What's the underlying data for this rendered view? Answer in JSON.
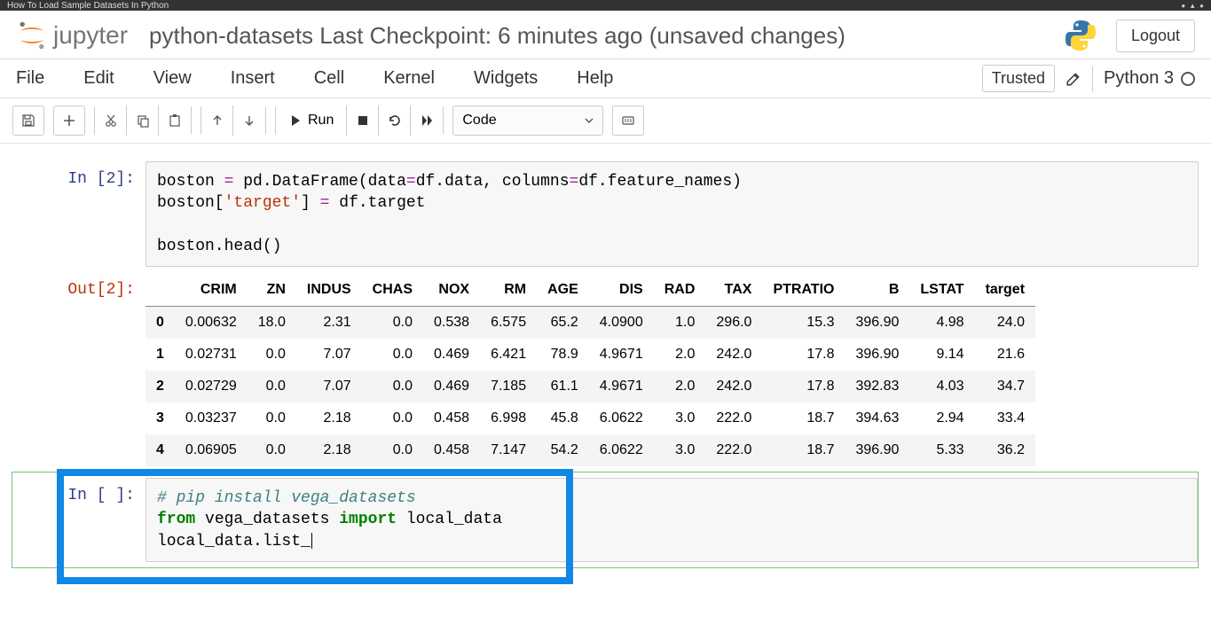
{
  "browser_tab_title": "How To Load Sample Datasets In Python",
  "logo_text": "jupyter",
  "notebook_title": "python-datasets Last Checkpoint: 6 minutes ago  (unsaved changes)",
  "logout_label": "Logout",
  "menus": {
    "file": "File",
    "edit": "Edit",
    "view": "View",
    "insert": "Insert",
    "cell": "Cell",
    "kernel": "Kernel",
    "widgets": "Widgets",
    "help": "Help"
  },
  "trusted_label": "Trusted",
  "kernel_label": "Python 3",
  "toolbar": {
    "run_label": "Run",
    "celltype_selected": "Code"
  },
  "cell1": {
    "prompt": "In [2]:",
    "code_line1a": "boston ",
    "code_line1b": "=",
    "code_line1c": " pd.DataFrame(data",
    "code_line1d": "=",
    "code_line1e": "df.data, columns",
    "code_line1f": "=",
    "code_line1g": "df.feature_names)",
    "code_line2a": "boston[",
    "code_line2b": "'target'",
    "code_line2c": "] ",
    "code_line2d": "=",
    "code_line2e": " df.target",
    "code_line3": "",
    "code_line4": "boston.head()"
  },
  "out1_prompt": "Out[2]:",
  "table": {
    "columns": [
      "CRIM",
      "ZN",
      "INDUS",
      "CHAS",
      "NOX",
      "RM",
      "AGE",
      "DIS",
      "RAD",
      "TAX",
      "PTRATIO",
      "B",
      "LSTAT",
      "target"
    ],
    "rows": [
      {
        "idx": "0",
        "vals": [
          "0.00632",
          "18.0",
          "2.31",
          "0.0",
          "0.538",
          "6.575",
          "65.2",
          "4.0900",
          "1.0",
          "296.0",
          "15.3",
          "396.90",
          "4.98",
          "24.0"
        ]
      },
      {
        "idx": "1",
        "vals": [
          "0.02731",
          "0.0",
          "7.07",
          "0.0",
          "0.469",
          "6.421",
          "78.9",
          "4.9671",
          "2.0",
          "242.0",
          "17.8",
          "396.90",
          "9.14",
          "21.6"
        ]
      },
      {
        "idx": "2",
        "vals": [
          "0.02729",
          "0.0",
          "7.07",
          "0.0",
          "0.469",
          "7.185",
          "61.1",
          "4.9671",
          "2.0",
          "242.0",
          "17.8",
          "392.83",
          "4.03",
          "34.7"
        ]
      },
      {
        "idx": "3",
        "vals": [
          "0.03237",
          "0.0",
          "2.18",
          "0.0",
          "0.458",
          "6.998",
          "45.8",
          "6.0622",
          "3.0",
          "222.0",
          "18.7",
          "394.63",
          "2.94",
          "33.4"
        ]
      },
      {
        "idx": "4",
        "vals": [
          "0.06905",
          "0.0",
          "2.18",
          "0.0",
          "0.458",
          "7.147",
          "54.2",
          "6.0622",
          "3.0",
          "222.0",
          "18.7",
          "396.90",
          "5.33",
          "36.2"
        ]
      }
    ]
  },
  "cell2": {
    "prompt": "In [ ]:",
    "line1": "# pip install vega_datasets",
    "line2a": "from",
    "line2b": " vega_datasets ",
    "line2c": "import",
    "line2d": " local_data",
    "line3": "local_data.list_"
  }
}
